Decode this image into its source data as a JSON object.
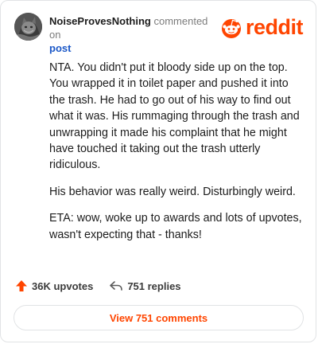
{
  "header": {
    "username": "NoiseProvesNothing",
    "action_text": "commented on",
    "target_text": "post",
    "brand": "reddit"
  },
  "comment": {
    "paragraphs": [
      "NTA. You didn't put it bloody side up on the top. You wrapped it in toilet paper and pushed it into the trash. He had to go out of his way to find out what it was. His rummaging through the trash and unwrapping it made his complaint that he might have touched it taking out the trash utterly ridiculous.",
      "His behavior was really weird. Disturbingly weird.",
      "ETA: wow, woke up to awards and lots of upvotes, wasn't expecting that - thanks!"
    ]
  },
  "actions": {
    "upvotes": "36K upvotes",
    "replies": "751 replies"
  },
  "footer": {
    "view_comments": "View 751 comments"
  },
  "colors": {
    "accent": "#ff4500",
    "link": "#1a57c7"
  }
}
